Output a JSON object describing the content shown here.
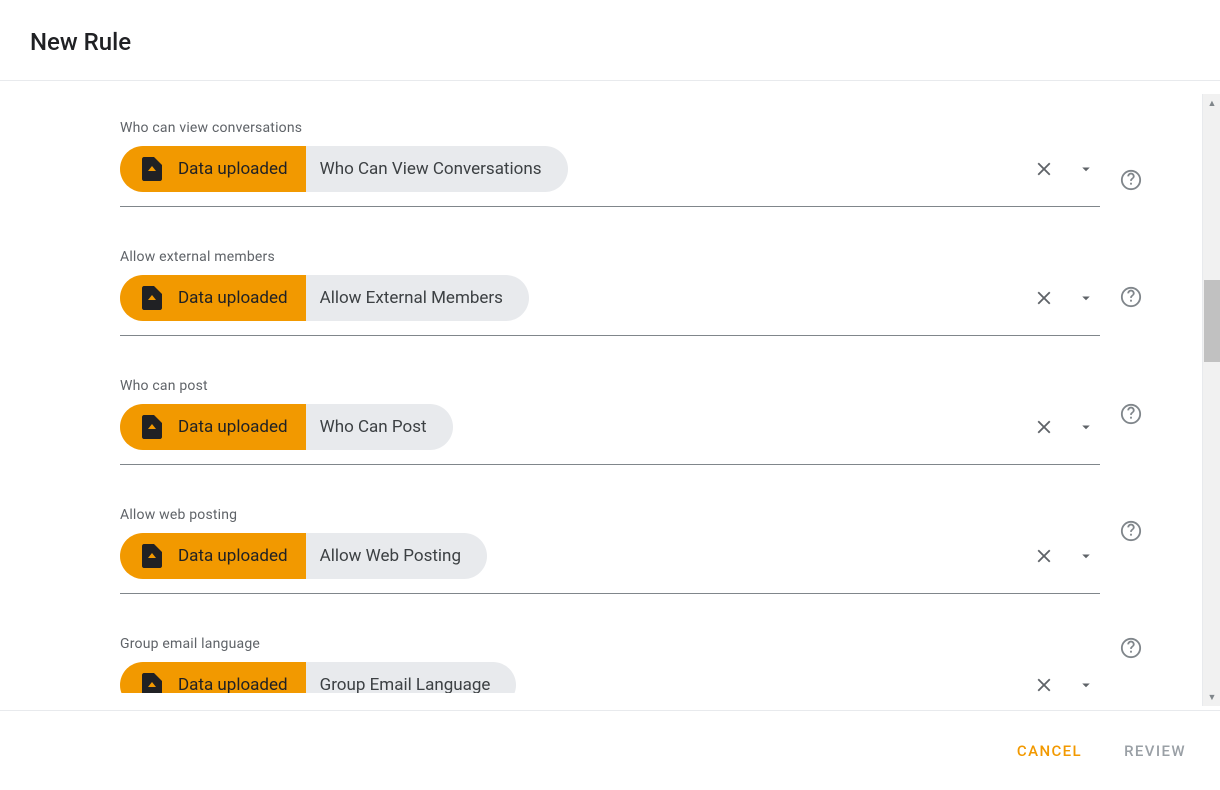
{
  "header": {
    "title": "New Rule"
  },
  "common": {
    "data_uploaded": "Data uploaded"
  },
  "rules": [
    {
      "label": "Who can view conversations",
      "value": "Who Can View Conversations"
    },
    {
      "label": "Allow external members",
      "value": "Allow External Members"
    },
    {
      "label": "Who can post",
      "value": "Who Can Post"
    },
    {
      "label": "Allow web posting",
      "value": "Allow Web Posting"
    },
    {
      "label": "Group email language",
      "value": "Group Email Language"
    }
  ],
  "footer": {
    "cancel": "CANCEL",
    "review": "REVIEW"
  },
  "colors": {
    "accent": "#f29900",
    "icon": "#5f6368",
    "muted": "#9aa0a6"
  }
}
